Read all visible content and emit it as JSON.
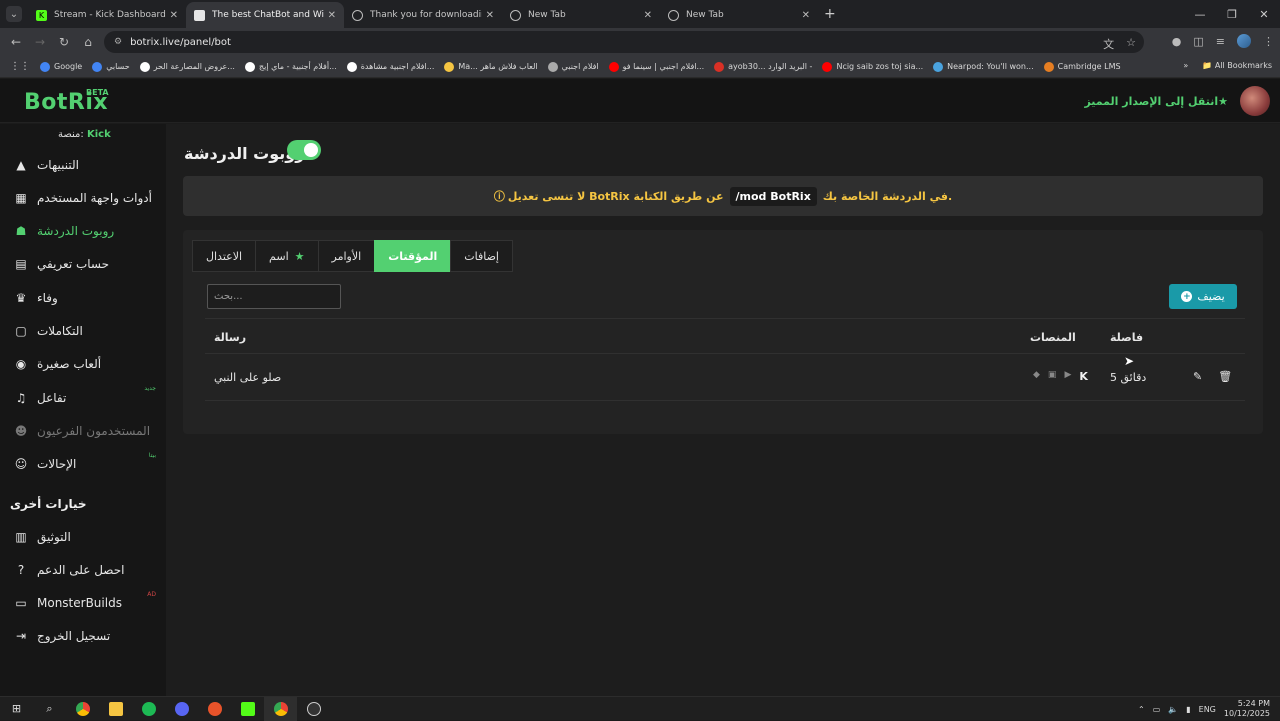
{
  "browser": {
    "tabs": [
      {
        "title": "Stream - Kick Dashboard",
        "active": false,
        "icon_color": "#53fc18"
      },
      {
        "title": "The best ChatBot and Widgets",
        "active": true,
        "icon_color": "#e6e6e6"
      },
      {
        "title": "Thank you for downloading An",
        "active": false,
        "icon_color": "#bbbbbb"
      },
      {
        "title": "New Tab",
        "active": false,
        "icon_color": "#bbbbbb"
      },
      {
        "title": "New Tab",
        "active": false,
        "icon_color": "#bbbbbb"
      }
    ],
    "url": "botrix.live/panel/bot",
    "bookmarks": [
      {
        "label": "Google",
        "color": "#4285f4"
      },
      {
        "label": "حسابي",
        "color": "#4285f4"
      },
      {
        "label": "عروض المصارعة الحر...",
        "color": "#ffffff"
      },
      {
        "label": "أفلام أجنبية - ماي إيج...",
        "color": "#ffffff"
      },
      {
        "label": "افلام اجنبية مشاهدة...",
        "color": "#ffffff"
      },
      {
        "label": "Ma... العاب فلاش ماهر",
        "color": "#f5c542"
      },
      {
        "label": "افلام اجنبي",
        "color": "#aaaaaa"
      },
      {
        "label": "افلام اجنبي | سينما فو...",
        "color": "#ff0000"
      },
      {
        "label": "ayob30... البريد الوارد -",
        "color": "#d93025"
      },
      {
        "label": "Ncig saib zos toj sia...",
        "color": "#ff0000"
      },
      {
        "label": "Nearpod: You'll won...",
        "color": "#4aa3df"
      },
      {
        "label": "Cambridge LMS",
        "color": "#e67e22"
      }
    ],
    "all_bookmarks": "All Bookmarks"
  },
  "header": {
    "logo": "BotRix",
    "beta": "BETA",
    "premium": "انتقل إلى الإصدار المميز"
  },
  "sidebar": {
    "platform_label": "منصة:",
    "platform_value": "Kick",
    "items": [
      {
        "label": "التنبيهات",
        "icon": "warning-icon"
      },
      {
        "label": "أدوات واجهة المستخدم",
        "icon": "grid-icon"
      },
      {
        "label": "روبوت الدردشة",
        "icon": "robot-icon"
      },
      {
        "label": "حساب تعريفي",
        "icon": "id-card-icon"
      },
      {
        "label": "وفاء",
        "icon": "trophy-icon"
      },
      {
        "label": "التكاملات",
        "icon": "integration-icon"
      },
      {
        "label": "ألعاب صغيرة",
        "icon": "gamepad-icon"
      },
      {
        "label": "تفاعل",
        "icon": "music-icon",
        "badge": "جديد"
      },
      {
        "label": "المستخدمون الفرعيون",
        "icon": "users-icon"
      },
      {
        "label": "الإحالات",
        "icon": "referral-icon",
        "badge": "بيتا"
      }
    ],
    "other_header": "خيارات أخرى",
    "other_items": [
      {
        "label": "التوثيق",
        "icon": "docs-icon"
      },
      {
        "label": "احصل على الدعم",
        "icon": "help-icon"
      },
      {
        "label": "MonsterBuilds",
        "icon": "laptop-icon",
        "badge": "AD"
      },
      {
        "label": "تسجيل الخروج",
        "icon": "logout-icon"
      }
    ]
  },
  "main": {
    "title": "روبوت الدردشة",
    "toggle_on": true,
    "notice_before": "في الدردشة الخاصة بك.",
    "notice_code": "/mod BotRix",
    "notice_after": "لا تنسى تعديل BotRix عن طريق الكتابة",
    "tabs": [
      "الاعتدال",
      "اسم",
      "الأوامر",
      "المؤقتات",
      "إضافات"
    ],
    "active_tab": "المؤقتات",
    "search_placeholder": "بحث...",
    "add_button": "يضيف",
    "columns": {
      "message": "رسالة",
      "platforms": "المنصات",
      "interval": "فاصلة"
    },
    "rows": [
      {
        "message": "صلو على النبي",
        "interval": "5 دقائق"
      }
    ]
  },
  "taskbar": {
    "lang": "ENG",
    "time": "5:24 PM",
    "date": "10/12/2025"
  }
}
